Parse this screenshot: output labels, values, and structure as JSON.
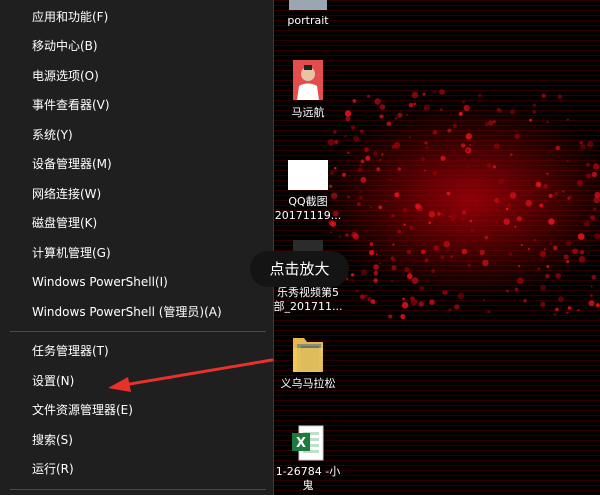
{
  "menu": {
    "items": [
      {
        "label": "应用和功能(F)"
      },
      {
        "label": "移动中心(B)"
      },
      {
        "label": "电源选项(O)"
      },
      {
        "label": "事件查看器(V)"
      },
      {
        "label": "系统(Y)"
      },
      {
        "label": "设备管理器(M)"
      },
      {
        "label": "网络连接(W)"
      },
      {
        "label": "磁盘管理(K)"
      },
      {
        "label": "计算机管理(G)"
      },
      {
        "label": "Windows PowerShell(I)"
      },
      {
        "label": "Windows PowerShell (管理员)(A)"
      },
      {
        "label": "任务管理器(T)"
      },
      {
        "label": "设置(N)"
      },
      {
        "label": "文件资源管理器(E)"
      },
      {
        "label": "搜索(S)"
      },
      {
        "label": "运行(R)"
      }
    ]
  },
  "desktop": {
    "icons": [
      {
        "label": "portrait",
        "icon": "image-file-icon"
      },
      {
        "label": "马远航",
        "icon": "photo-file-icon"
      },
      {
        "label_line1": "QQ截图",
        "label_line2": "20171119...",
        "icon": "screenshot-file-icon"
      },
      {
        "label_line1": "乐秀视频第5",
        "label_line2": "部_201711...",
        "icon": "video-file-icon"
      },
      {
        "label": "义乌马拉松",
        "icon": "folder-icon"
      },
      {
        "label_line1": "1-26784 -小",
        "label_line2": "鬼",
        "icon": "excel-file-icon"
      }
    ]
  },
  "tooltip": {
    "text": "点击放大"
  },
  "colors": {
    "menu_bg": "#1f1f1f",
    "annotation_arrow": "#e8312a",
    "wallpaper_red": "#c00010"
  }
}
